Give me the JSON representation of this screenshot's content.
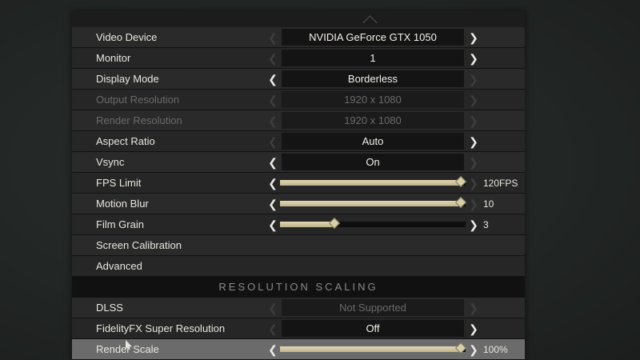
{
  "settings": {
    "video_device": {
      "label": "Video Device",
      "value": "NVIDIA GeForce GTX 1050"
    },
    "monitor": {
      "label": "Monitor",
      "value": "1"
    },
    "display_mode": {
      "label": "Display Mode",
      "value": "Borderless"
    },
    "output_resolution": {
      "label": "Output Resolution",
      "value": "1920 x 1080"
    },
    "render_resolution": {
      "label": "Render Resolution",
      "value": "1920 x 1080"
    },
    "aspect_ratio": {
      "label": "Aspect Ratio",
      "value": "Auto"
    },
    "vsync": {
      "label": "Vsync",
      "value": "On"
    },
    "fps_limit": {
      "label": "FPS Limit",
      "display": "120FPS",
      "level": 1.0
    },
    "motion_blur": {
      "label": "Motion Blur",
      "display": "10",
      "level": 1.0
    },
    "film_grain": {
      "label": "Film Grain",
      "display": "3",
      "level": 0.3
    },
    "screen_calibration": {
      "label": "Screen Calibration"
    },
    "advanced": {
      "label": "Advanced"
    }
  },
  "resolution_scaling": {
    "header": "RESOLUTION SCALING",
    "dlss": {
      "label": "DLSS",
      "value": "Not Supported"
    },
    "fsr": {
      "label": "FidelityFX Super Resolution",
      "value": "Off"
    },
    "render_scale": {
      "label": "Render Scale",
      "display": "100%",
      "level": 1.0
    }
  },
  "icons": {
    "left": "chevron-left-icon",
    "right": "chevron-right-icon"
  },
  "colors": {
    "accent": "#d7cfa9",
    "panel": "#2a2a2a",
    "highlight": "#6b6b6b"
  }
}
